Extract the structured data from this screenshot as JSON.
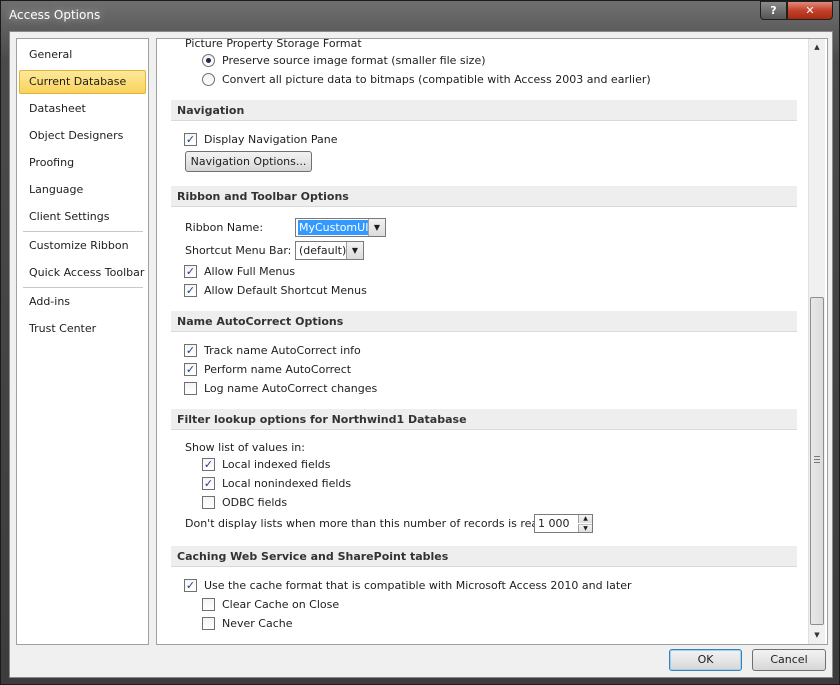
{
  "window": {
    "title": "Access Options",
    "help": "?",
    "close": "✕"
  },
  "sidebar": {
    "items": [
      {
        "label": "General",
        "selected": false
      },
      {
        "label": "Current Database",
        "selected": true
      },
      {
        "label": "Datasheet",
        "selected": false
      },
      {
        "label": "Object Designers",
        "selected": false
      },
      {
        "label": "Proofing",
        "selected": false
      },
      {
        "label": "Language",
        "selected": false
      },
      {
        "label": "Client Settings",
        "selected": false
      },
      {
        "label": "Customize Ribbon",
        "selected": false
      },
      {
        "label": "Quick Access Toolbar",
        "selected": false
      },
      {
        "label": "Add-ins",
        "selected": false
      },
      {
        "label": "Trust Center",
        "selected": false
      }
    ]
  },
  "picture_storage": {
    "heading": "Picture Property Storage Format",
    "preserve": {
      "label": "Preserve source image format (smaller file size)",
      "selected": true
    },
    "convert": {
      "label": "Convert all picture data to bitmaps (compatible with Access 2003 and earlier)",
      "selected": false
    }
  },
  "navigation": {
    "header": "Navigation",
    "display_pane": {
      "label": "Display Navigation Pane",
      "checked": true
    },
    "options_button": "Navigation Options..."
  },
  "ribbon": {
    "header": "Ribbon and Toolbar Options",
    "ribbon_name_label": "Ribbon Name:",
    "ribbon_name_value": "MyCustomUI",
    "shortcut_label": "Shortcut Menu Bar:",
    "shortcut_value": "(default)",
    "full_menus": {
      "label": "Allow Full Menus",
      "checked": true
    },
    "default_shortcut": {
      "label": "Allow Default Shortcut Menus",
      "checked": true
    }
  },
  "autocorrect": {
    "header": "Name AutoCorrect Options",
    "track": {
      "label": "Track name AutoCorrect info",
      "checked": true
    },
    "perform": {
      "label": "Perform name AutoCorrect",
      "checked": true
    },
    "log": {
      "label": "Log name AutoCorrect changes",
      "checked": false
    }
  },
  "filter": {
    "header": "Filter lookup options for Northwind1 Database",
    "show_list_label": "Show list of values in:",
    "local_indexed": {
      "label": "Local indexed fields",
      "checked": true
    },
    "local_nonindexed": {
      "label": "Local nonindexed fields",
      "checked": true
    },
    "odbc": {
      "label": "ODBC fields",
      "checked": false
    },
    "records_label": "Don't display lists when more than this number of records is read:",
    "records_value": "1 000"
  },
  "caching": {
    "header": "Caching Web Service and SharePoint tables",
    "use_cache": {
      "label": "Use the cache format that is compatible with Microsoft Access 2010 and later",
      "checked": true
    },
    "clear_cache": {
      "label": "Clear Cache on Close",
      "checked": false
    },
    "never_cache": {
      "label": "Never Cache",
      "checked": false
    }
  },
  "footer": {
    "ok": "OK",
    "cancel": "Cancel"
  },
  "icons": {
    "check": "✓",
    "combo_arrow": "▼",
    "spin_up": "▲",
    "spin_down": "▼",
    "scroll_up": "▲",
    "scroll_down": "▼"
  }
}
